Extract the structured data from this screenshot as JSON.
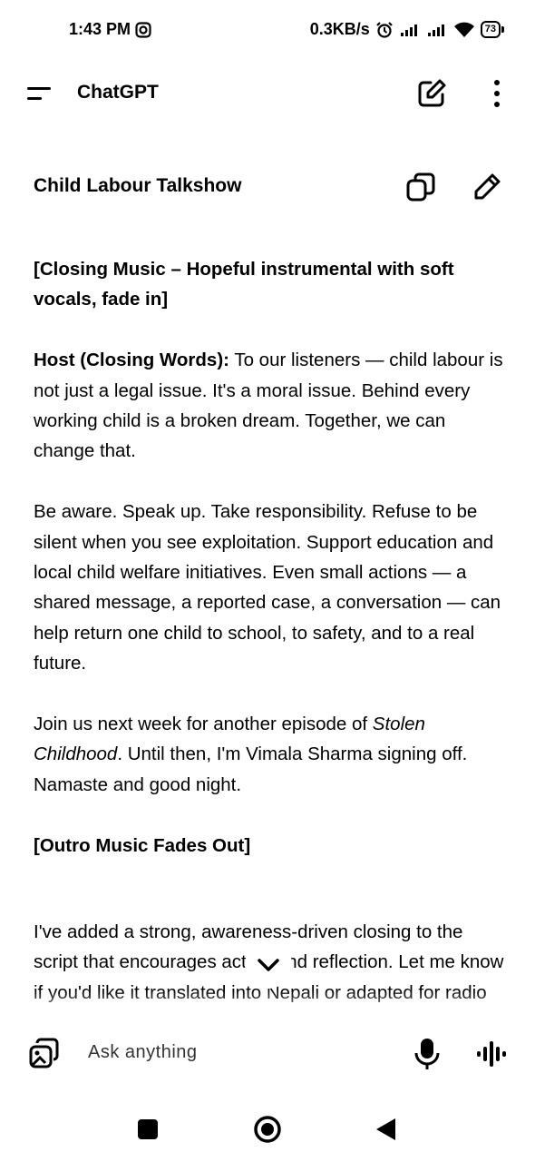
{
  "status_bar": {
    "time": "1:43 PM",
    "net_speed": "0.3KB/s",
    "battery": "73"
  },
  "header": {
    "app_title": "ChatGPT"
  },
  "conversation": {
    "title": "Child Labour Talkshow"
  },
  "message": {
    "p1_bold": "[Closing Music – Hopeful instrumental with soft vocals, fade in]",
    "p2_bold": "Host (Closing Words):",
    "p2_text": " To our listeners — child labour is not just a legal issue. It's a moral issue. Behind every working child is a broken dream. Together, we can change that.",
    "p3_text": "Be aware. Speak up. Take responsibility. Refuse to be silent when you see exploitation. Support education and local child welfare initiatives. Even small actions — a shared message, a reported case, a conversation — can help return one child to school, to safety, and to a real future.",
    "p4_text1": "Join us next week for another episode of ",
    "p4_italic": "Stolen Childhood",
    "p4_text2": ". Until then, I'm Vimala Sharma signing off. Namaste and good night.",
    "p5_bold": "[Outro Music Fades Out]",
    "p6_text": "I've added a strong, awareness-driven closing to the script that encourages action and reflection. Let me know if you'd like it translated into Nepali or adapted for radio or video."
  },
  "composer": {
    "placeholder": "Ask anything"
  }
}
